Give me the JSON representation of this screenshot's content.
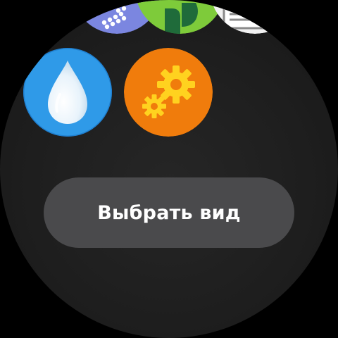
{
  "apps": {
    "top_left": {
      "icon": "dotted-blue-app-icon",
      "color": "#7b86e0"
    },
    "top_middle": {
      "icon": "green-leaf-app-icon",
      "color": "#7ecb3a"
    },
    "top_right": {
      "icon": "white-document-app-icon",
      "color": "#f2f2f2"
    },
    "water": {
      "icon": "water-drop-icon",
      "color": "#2f9ae8"
    },
    "settings": {
      "icon": "gears-icon",
      "color": "#f07c0c"
    }
  },
  "button": {
    "label": "Выбрать вид"
  }
}
